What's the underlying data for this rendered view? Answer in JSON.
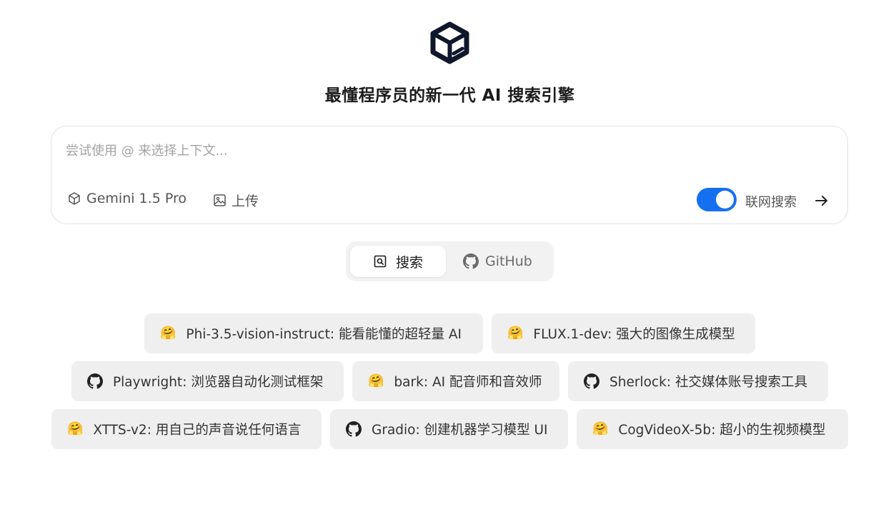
{
  "headline": "最懂程序员的新一代 AI 搜索引擎",
  "search": {
    "placeholder": "尝试使用 @ 来选择上下文...",
    "model_label": "Gemini 1.5 Pro",
    "upload_label": "上传",
    "web_search_label": "联网搜索",
    "web_search_enabled": true,
    "accent_color": "#1570ef"
  },
  "tabs": [
    {
      "label": "搜索",
      "icon": "search-icon",
      "active": true
    },
    {
      "label": "GitHub",
      "icon": "github-icon",
      "active": false
    }
  ],
  "suggestions": [
    {
      "icon": "hugging-face-icon",
      "name": "Phi-3.5-vision-instruct",
      "desc": "能看能懂的超轻量 AI"
    },
    {
      "icon": "hugging-face-icon",
      "name": "FLUX.1-dev",
      "desc": "强大的图像生成模型"
    },
    {
      "icon": "github-icon",
      "name": "Playwright",
      "desc": "浏览器自动化测试框架"
    },
    {
      "icon": "hugging-face-icon",
      "name": "bark",
      "desc": "AI 配音师和音效师"
    },
    {
      "icon": "github-icon",
      "name": "Sherlock",
      "desc": "社交媒体账号搜索工具"
    },
    {
      "icon": "hugging-face-icon",
      "name": "XTTS-v2",
      "desc": "用自己的声音说任何语言"
    },
    {
      "icon": "github-icon",
      "name": "Gradio",
      "desc": "创建机器学习模型 UI"
    },
    {
      "icon": "hugging-face-icon",
      "name": "CogVideoX-5b",
      "desc": "超小的生视频模型"
    }
  ]
}
